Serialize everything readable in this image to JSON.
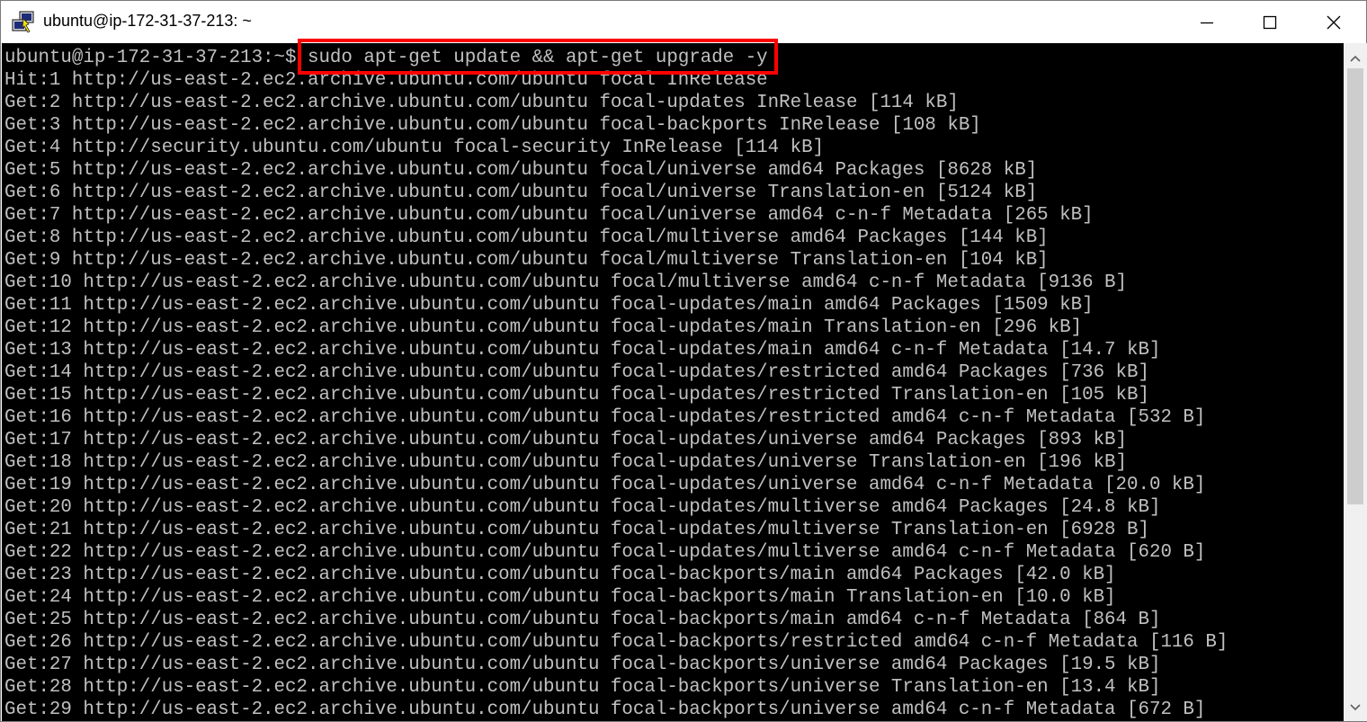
{
  "window": {
    "title": "ubuntu@ip-172-31-37-213: ~",
    "icon": "putty-icon",
    "controls": {
      "minimize_icon": "minimize-icon",
      "maximize_icon": "maximize-icon",
      "close_icon": "close-icon"
    }
  },
  "terminal": {
    "prompt": "ubuntu@ip-172-31-37-213:~$ ",
    "command": "sudo apt-get update && apt-get upgrade -y",
    "highlight_color": "#ff0000",
    "output": [
      "Hit:1 http://us-east-2.ec2.archive.ubuntu.com/ubuntu focal InRelease",
      "Get:2 http://us-east-2.ec2.archive.ubuntu.com/ubuntu focal-updates InRelease [114 kB]",
      "Get:3 http://us-east-2.ec2.archive.ubuntu.com/ubuntu focal-backports InRelease [108 kB]",
      "Get:4 http://security.ubuntu.com/ubuntu focal-security InRelease [114 kB]",
      "Get:5 http://us-east-2.ec2.archive.ubuntu.com/ubuntu focal/universe amd64 Packages [8628 kB]",
      "Get:6 http://us-east-2.ec2.archive.ubuntu.com/ubuntu focal/universe Translation-en [5124 kB]",
      "Get:7 http://us-east-2.ec2.archive.ubuntu.com/ubuntu focal/universe amd64 c-n-f Metadata [265 kB]",
      "Get:8 http://us-east-2.ec2.archive.ubuntu.com/ubuntu focal/multiverse amd64 Packages [144 kB]",
      "Get:9 http://us-east-2.ec2.archive.ubuntu.com/ubuntu focal/multiverse Translation-en [104 kB]",
      "Get:10 http://us-east-2.ec2.archive.ubuntu.com/ubuntu focal/multiverse amd64 c-n-f Metadata [9136 B]",
      "Get:11 http://us-east-2.ec2.archive.ubuntu.com/ubuntu focal-updates/main amd64 Packages [1509 kB]",
      "Get:12 http://us-east-2.ec2.archive.ubuntu.com/ubuntu focal-updates/main Translation-en [296 kB]",
      "Get:13 http://us-east-2.ec2.archive.ubuntu.com/ubuntu focal-updates/main amd64 c-n-f Metadata [14.7 kB]",
      "Get:14 http://us-east-2.ec2.archive.ubuntu.com/ubuntu focal-updates/restricted amd64 Packages [736 kB]",
      "Get:15 http://us-east-2.ec2.archive.ubuntu.com/ubuntu focal-updates/restricted Translation-en [105 kB]",
      "Get:16 http://us-east-2.ec2.archive.ubuntu.com/ubuntu focal-updates/restricted amd64 c-n-f Metadata [532 B]",
      "Get:17 http://us-east-2.ec2.archive.ubuntu.com/ubuntu focal-updates/universe amd64 Packages [893 kB]",
      "Get:18 http://us-east-2.ec2.archive.ubuntu.com/ubuntu focal-updates/universe Translation-en [196 kB]",
      "Get:19 http://us-east-2.ec2.archive.ubuntu.com/ubuntu focal-updates/universe amd64 c-n-f Metadata [20.0 kB]",
      "Get:20 http://us-east-2.ec2.archive.ubuntu.com/ubuntu focal-updates/multiverse amd64 Packages [24.8 kB]",
      "Get:21 http://us-east-2.ec2.archive.ubuntu.com/ubuntu focal-updates/multiverse Translation-en [6928 B]",
      "Get:22 http://us-east-2.ec2.archive.ubuntu.com/ubuntu focal-updates/multiverse amd64 c-n-f Metadata [620 B]",
      "Get:23 http://us-east-2.ec2.archive.ubuntu.com/ubuntu focal-backports/main amd64 Packages [42.0 kB]",
      "Get:24 http://us-east-2.ec2.archive.ubuntu.com/ubuntu focal-backports/main Translation-en [10.0 kB]",
      "Get:25 http://us-east-2.ec2.archive.ubuntu.com/ubuntu focal-backports/main amd64 c-n-f Metadata [864 B]",
      "Get:26 http://us-east-2.ec2.archive.ubuntu.com/ubuntu focal-backports/restricted amd64 c-n-f Metadata [116 B]",
      "Get:27 http://us-east-2.ec2.archive.ubuntu.com/ubuntu focal-backports/universe amd64 Packages [19.5 kB]",
      "Get:28 http://us-east-2.ec2.archive.ubuntu.com/ubuntu focal-backports/universe Translation-en [13.4 kB]",
      "Get:29 http://us-east-2.ec2.archive.ubuntu.com/ubuntu focal-backports/universe amd64 c-n-f Metadata [672 B]"
    ]
  },
  "scrollbar": {
    "up_icon": "scroll-up-arrow-icon",
    "down_icon": "scroll-down-arrow-icon"
  }
}
